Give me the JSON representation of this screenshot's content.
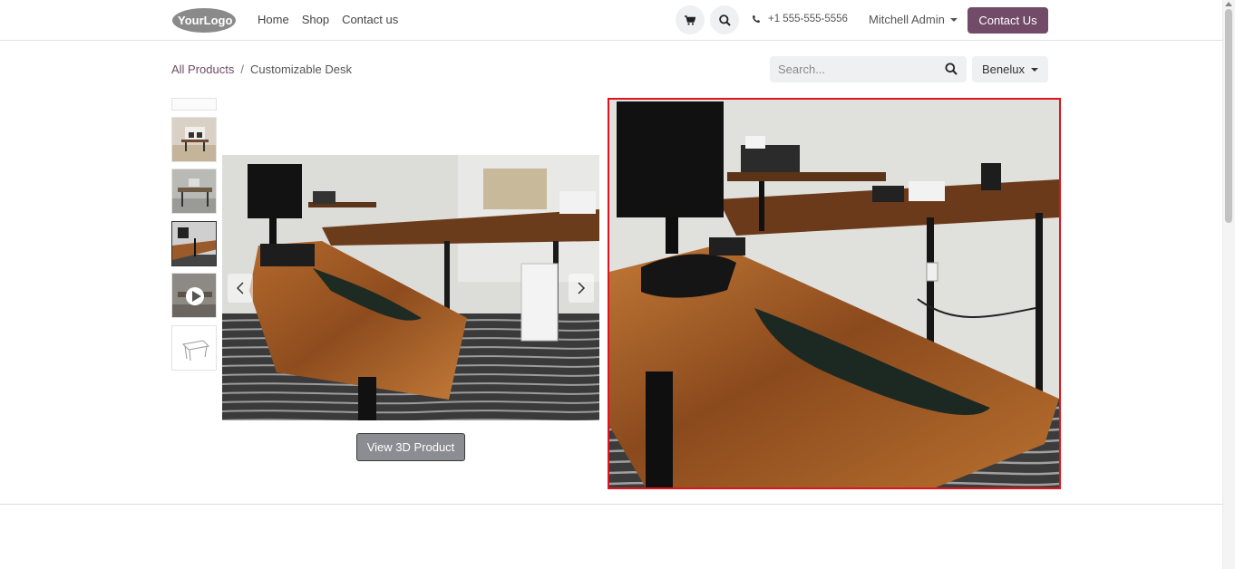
{
  "header": {
    "logo_text": "YourLogo",
    "nav": [
      "Home",
      "Shop",
      "Contact us"
    ],
    "phone": "+1 555-555-5556",
    "user": "Mitchell Admin",
    "contact_button": "Contact Us"
  },
  "breadcrumb": {
    "parent": "All Products",
    "separator": "/",
    "current": "Customizable Desk"
  },
  "search": {
    "placeholder": "Search..."
  },
  "pricelist": {
    "selected": "Benelux"
  },
  "gallery": {
    "thumbnails": [
      "blank",
      "office-room",
      "desk-laptop",
      "walnut-desk",
      "video",
      "desk-sketch"
    ],
    "selected_thumbnail": "walnut-desk",
    "view_3d_button": "View 3D Product"
  },
  "colors": {
    "brand": "#714b67",
    "zoom_border": "#e0141e"
  }
}
